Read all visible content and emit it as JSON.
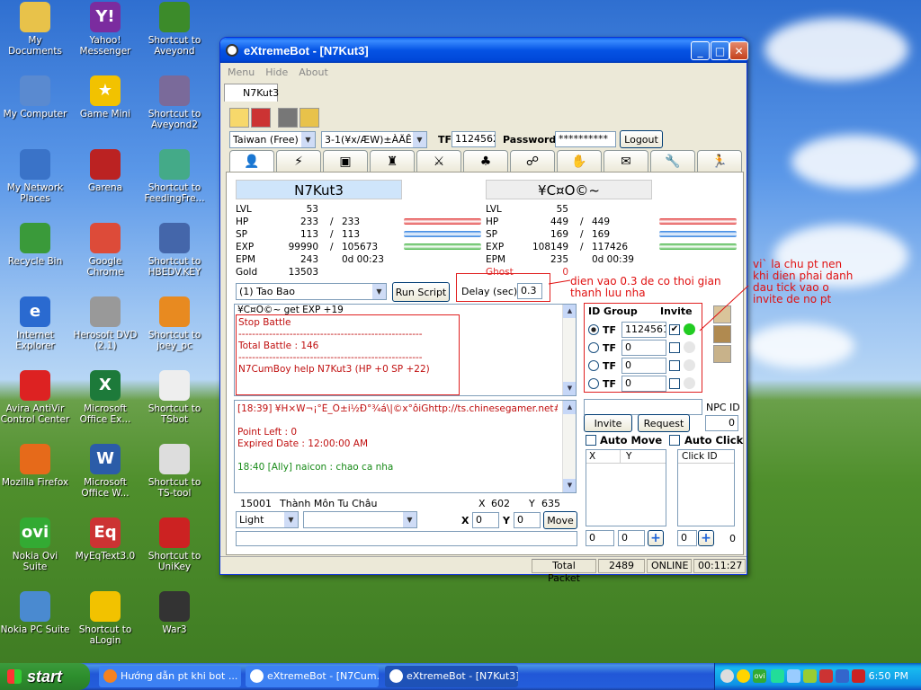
{
  "desktop": {
    "icons": [
      {
        "label": "My Documents"
      },
      {
        "label": "Yahoo!\nMessenger",
        "glyph": "Y!"
      },
      {
        "label": "Shortcut to\nAveyond"
      },
      {
        "label": "My Computer"
      },
      {
        "label": "Game Mini",
        "glyph": "★"
      },
      {
        "label": "Shortcut to\nAveyond2"
      },
      {
        "label": "My Network\nPlaces"
      },
      {
        "label": "Garena"
      },
      {
        "label": "Shortcut to\nFeedingFre..."
      },
      {
        "label": "Recycle Bin"
      },
      {
        "label": "Google Chrome"
      },
      {
        "label": "Shortcut to\nHBEDV.KEY"
      },
      {
        "label": "Internet\nExplorer",
        "glyph": "e"
      },
      {
        "label": "Herosoft DVD\n(2.1)"
      },
      {
        "label": "Shortcut to\njoey_pc"
      },
      {
        "label": "Avira AntiVir\nControl Center"
      },
      {
        "label": "Microsoft\nOffice Ex...",
        "glyph": "X"
      },
      {
        "label": "Shortcut to\nTSbot"
      },
      {
        "label": "Mozilla Firefox"
      },
      {
        "label": "Microsoft\nOffice W...",
        "glyph": "W"
      },
      {
        "label": "Shortcut to\nTS-tool"
      },
      {
        "label": "Nokia Ovi Suite",
        "glyph": "ovi"
      },
      {
        "label": "MyEqText3.0",
        "glyph": "Eq"
      },
      {
        "label": "Shortcut to\nUniKey"
      },
      {
        "label": "Nokia PC Suite"
      },
      {
        "label": "Shortcut to\naLogin"
      },
      {
        "label": "War3"
      }
    ]
  },
  "window": {
    "title": "eXtremeBot - [N7Kut3]",
    "menu": [
      "Menu",
      "Hide",
      "About"
    ],
    "doc_tab": "N7Kut3",
    "server_select": "Taiwan (Free)",
    "channel_select": "3-1(¥x/ÆW)±ÀÄÊ",
    "tf_label": "TF",
    "tf_value": "1124562",
    "password_label": "Password",
    "password_value": "**********",
    "logout_label": "Logout",
    "char1": {
      "name": "N7Kut3",
      "lvl": "53",
      "hp": "233",
      "hp_max": "233",
      "sp": "113",
      "sp_max": "113",
      "exp": "99990",
      "exp_max": "105673",
      "epm": "243",
      "epm_time": "0d 00:23",
      "gold": "13503"
    },
    "char2": {
      "name": "¥C¤O©~",
      "lvl": "55",
      "hp": "449",
      "hp_max": "449",
      "sp": "169",
      "sp_max": "169",
      "exp": "108149",
      "exp_max": "117426",
      "epm": "235",
      "epm_time": "0d 00:39",
      "ghost_label": "Ghost",
      "ghost": "0"
    },
    "labels": {
      "lvl": "LVL",
      "hp": "HP",
      "sp": "SP",
      "exp": "EXP",
      "epm": "EPM",
      "gold": "Gold",
      "slash": "/"
    },
    "script_select": "(1) Tao Bao",
    "run_script": "Run Script",
    "delay_label": "Delay (sec)",
    "delay_value": "0.3",
    "battle_log": {
      "header": "¥C¤O©~ get EXP +19",
      "line1": "Stop Battle",
      "sep": "------------------------------------------------------",
      "line2": "Total Battle : 146",
      "line3": "N7CumBoy help N7Kut3 (HP +0  SP +22)"
    },
    "chat_log": {
      "line1": "[18:39] ¥H×W¬¡°Ê_Ô±i½Ð°¾á\\|©x°ôiGhttp://ts.chinesegamer.net#end",
      "line2": "Point Left : 0",
      "line3": "Expired Date : 12:00:00 AM",
      "line4": "18:40 [Ally] naicon : chao ca nha"
    },
    "map_id": "15001",
    "map_name": "Thành Môn Tu Châu",
    "coord_x_label": "X",
    "coord_x": "602",
    "coord_y_label": "Y",
    "coord_y": "635",
    "light_select": "Light",
    "move_x_label": "X",
    "move_x": "0",
    "move_y_label": "Y",
    "move_y": "0",
    "move_btn": "Move",
    "group": {
      "header_id": "ID Group",
      "header_invite": "Invite",
      "rows": [
        {
          "tf": "TF",
          "id": "1124561",
          "checked": "✔"
        },
        {
          "tf": "TF",
          "id": "0",
          "checked": ""
        },
        {
          "tf": "TF",
          "id": "0",
          "checked": ""
        },
        {
          "tf": "TF",
          "id": "0",
          "checked": ""
        }
      ]
    },
    "npc_id_label": "NPC ID",
    "npc_id_value": "0",
    "invite_btn": "Invite",
    "request_btn": "Request",
    "auto_move": "Auto Move",
    "auto_click": "Auto Click",
    "col_x": "X",
    "col_y": "Y",
    "col_click": "Click ID",
    "am_x": "0",
    "am_y": "0",
    "ac_id": "0",
    "ac_val": "0",
    "status": {
      "total_packet_label": "Total Packet",
      "total_packet": "2489",
      "state": "ONLINE",
      "time": "00:11:27"
    }
  },
  "annotations": {
    "delay_note": "dien vao 0.3 de co thoi gian\nthanh luu nha",
    "invite_note": "vi` la chu pt nen\nkhi dien phai danh\ndau tick vao o\ninvite de no pt"
  },
  "taskbar": {
    "start": "start",
    "tasks": [
      "Hướng dẫn pt khi bot ...",
      "eXtremeBot - [N7Cum...",
      "eXtremeBot - [N7Kut3]"
    ],
    "clock": "6:50 PM",
    "tray_ovi": "ovi"
  },
  "colors": {
    "hp": "#e03030",
    "sp": "#2a7de0",
    "exp": "#3ab03a",
    "annotation": "#e01010",
    "ghost": "#e03030",
    "online_dot": "#22cc22"
  }
}
